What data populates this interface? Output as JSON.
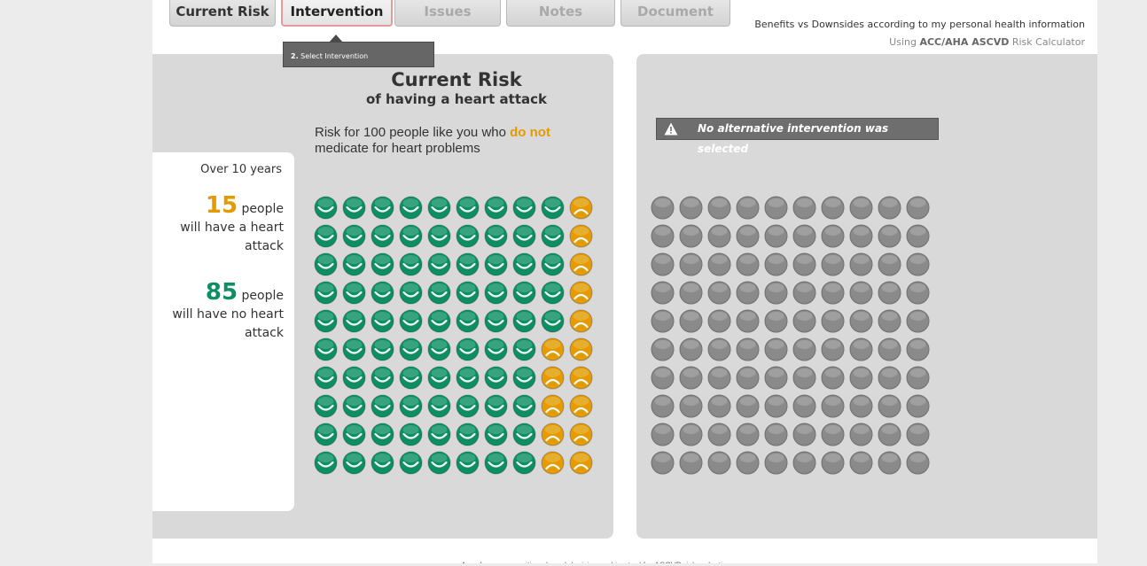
{
  "tabs": [
    {
      "label": "Current Risk",
      "state": "normal"
    },
    {
      "label": "Intervention",
      "state": "active"
    },
    {
      "label": "Issues",
      "state": "disabled"
    },
    {
      "label": "Notes",
      "state": "disabled"
    },
    {
      "label": "Document",
      "state": "disabled"
    }
  ],
  "tooltip": {
    "step": "2.",
    "text": "Select Intervention"
  },
  "header": {
    "line1": "Benefits vs Downsides according to my personal health information",
    "line2_prefix": "Using",
    "line2_bold": "ACC/AHA ASCVD",
    "line2_suffix": "Risk Calculator"
  },
  "left_panel": {
    "title": "Current Risk",
    "subtitle": "of having a heart attack",
    "desc_before": "Risk for 100 people like you who",
    "desc_highlight": "do not",
    "desc_after": "medicate for heart problems"
  },
  "side_card": {
    "period": "Over 10 years",
    "stat1_num": "15",
    "stat1_word": "people",
    "stat1_rest": "will have a heart attack",
    "stat2_num": "85",
    "stat2_word": "people",
    "stat2_rest": "will have no heart attack"
  },
  "right_panel": {
    "warning": "No alternative intervention was selected",
    "warning_icon": "warning-triangle-icon"
  },
  "chart_data": {
    "type": "pictograph",
    "total": 100,
    "rows": 10,
    "columns": 10,
    "heart_attack_count": 15,
    "no_heart_attack_count": 85,
    "per_row_heart_attack": [
      1,
      1,
      1,
      1,
      1,
      2,
      2,
      2,
      2,
      2
    ],
    "colors": {
      "heart_attack": "#e39b00",
      "no_heart_attack": "#0b8f63",
      "not_selected": "#8a8a8a"
    }
  },
  "footer": {
    "text": "A preference-sensitive shared decision making tool for ASCVD risk reduction"
  }
}
